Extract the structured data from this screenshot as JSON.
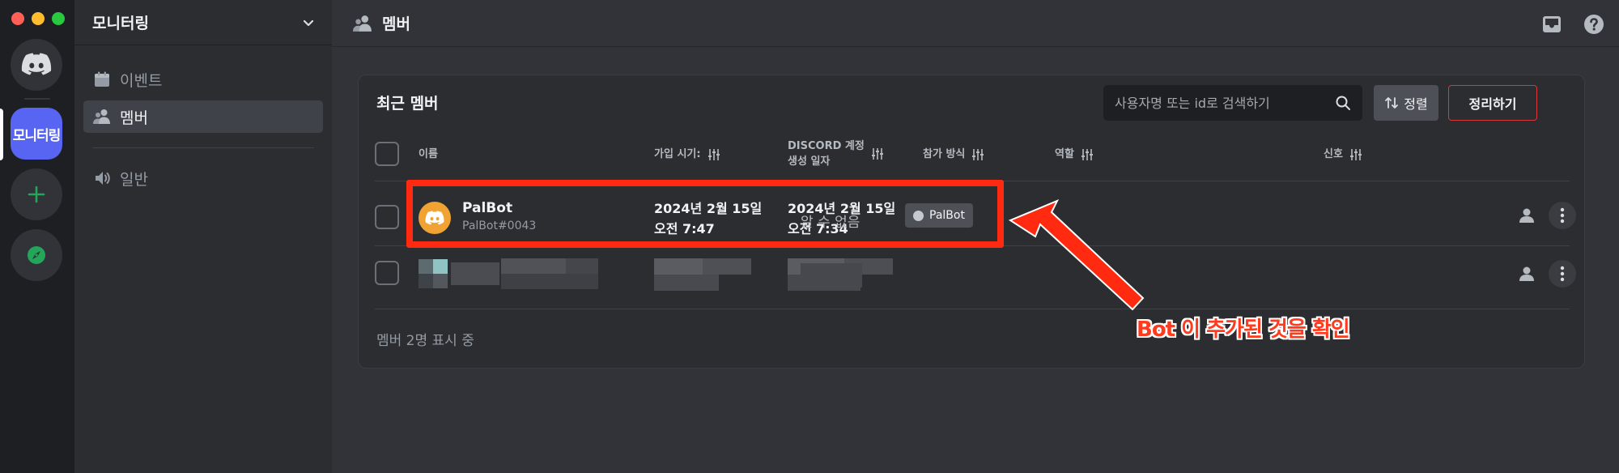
{
  "server_rail": {
    "active_server_label": "모니터링"
  },
  "sidebar": {
    "guild_name": "모니터링",
    "items": [
      {
        "label": "이벤트"
      },
      {
        "label": "멤버"
      },
      {
        "label": "일반"
      }
    ]
  },
  "header": {
    "title": "멤버"
  },
  "members": {
    "card_title": "최근 멤버",
    "search": {
      "placeholder": "사용자명 또는 id로 검색하기"
    },
    "sort_label": "정렬",
    "prune_label": "정리하기",
    "columns": {
      "name": "이름",
      "joined": "가입 시기:",
      "created_line1": "DISCORD 계정",
      "created_line2": "생성 일자",
      "method": "참가 방식",
      "roles": "역할",
      "signals": "신호"
    },
    "rows": [
      {
        "name": "PalBot",
        "tag": "PalBot#0043",
        "joined_date": "2024년 2월 15일",
        "joined_time": "오전 7:47",
        "created_date": "2024년 2월 15일",
        "created_time": "오전 7:34",
        "join_method": "알 수 없음",
        "role": "PalBot"
      }
    ],
    "count_text": "멤버 2명 표시 중"
  },
  "annotation": {
    "text": "Bot 이 추가된 것을 확인",
    "color": "#ff2a10"
  },
  "colors": {
    "blurple": "#5865f2",
    "bot_avatar": "#f0a232",
    "danger": "#da373c",
    "green": "#23a55a"
  }
}
